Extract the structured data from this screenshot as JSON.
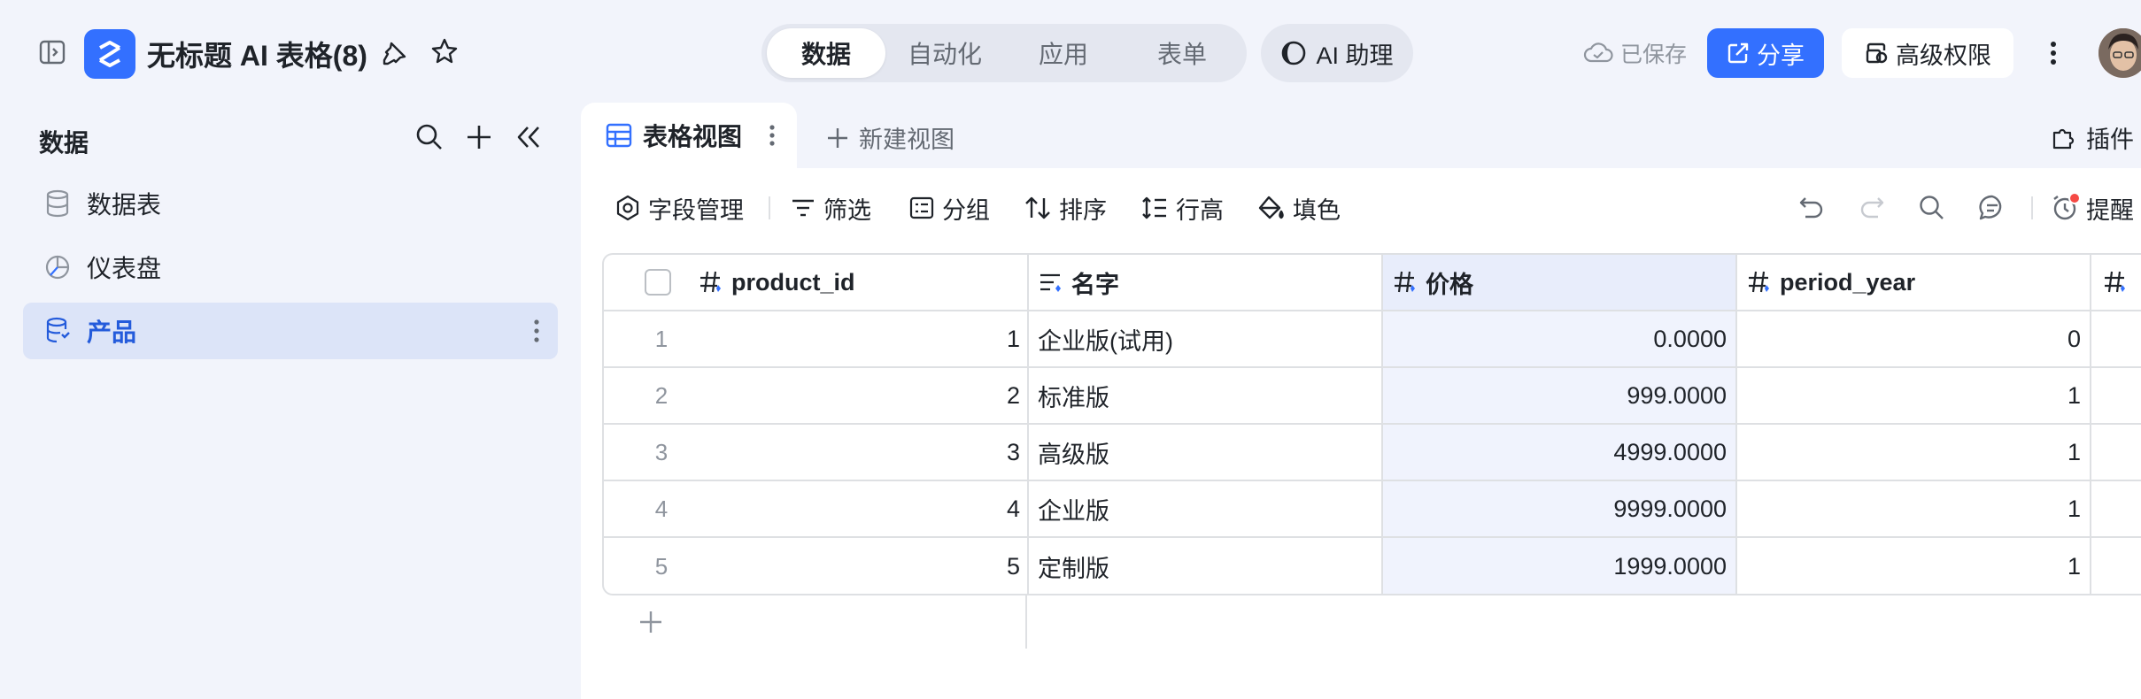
{
  "header": {
    "doc_title": "无标题 AI 表格(8)",
    "tabs": [
      {
        "label": "数据",
        "active": true
      },
      {
        "label": "自动化",
        "active": false
      },
      {
        "label": "应用",
        "active": false
      },
      {
        "label": "表单",
        "active": false
      }
    ],
    "ai_assistant": "AI 助理",
    "saved_status": "已保存",
    "share_label": "分享",
    "permissions_label": "高级权限",
    "accent_color": "#3370ff"
  },
  "sidebar": {
    "title": "数据",
    "items": [
      {
        "label": "数据表",
        "icon": "database-icon",
        "active": false
      },
      {
        "label": "仪表盘",
        "icon": "dashboard-icon",
        "active": false
      },
      {
        "label": "产品",
        "icon": "table-icon",
        "active": true
      }
    ]
  },
  "views": {
    "active_view": "表格视图",
    "new_view": "新建视图",
    "plugins": "插件"
  },
  "toolbar": {
    "field_manage": "字段管理",
    "filter": "筛选",
    "group": "分组",
    "sort": "排序",
    "row_height": "行高",
    "fill_color": "填色",
    "reminder": "提醒"
  },
  "table": {
    "columns": [
      "product_id",
      "名字",
      "价格",
      "period_year"
    ],
    "rows": [
      {
        "num": "1",
        "product_id": "1",
        "name": "企业版(试用)",
        "price": "0.0000",
        "period_year": "0"
      },
      {
        "num": "2",
        "product_id": "2",
        "name": "标准版",
        "price": "999.0000",
        "period_year": "1"
      },
      {
        "num": "3",
        "product_id": "3",
        "name": "高级版",
        "price": "4999.0000",
        "period_year": "1"
      },
      {
        "num": "4",
        "product_id": "4",
        "name": "企业版",
        "price": "9999.0000",
        "period_year": "1"
      },
      {
        "num": "5",
        "product_id": "5",
        "name": "定制版",
        "price": "1999.0000",
        "period_year": "1"
      }
    ]
  }
}
